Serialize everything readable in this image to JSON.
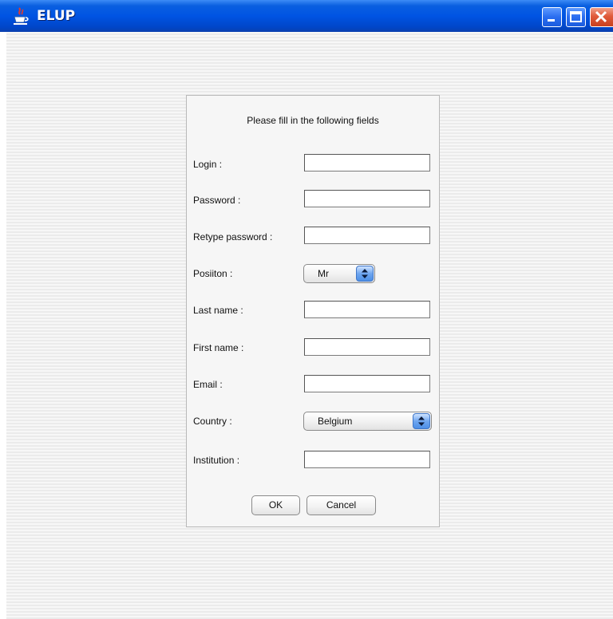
{
  "window": {
    "title": "ELUP",
    "icon": "java-cup-icon"
  },
  "form": {
    "heading": "Please fill in the following fields",
    "login_label": "Login :",
    "login_value": "",
    "password_label": "Password :",
    "password_value": "",
    "retype_label": "Retype password :",
    "retype_value": "",
    "position_label": "Posiiton :",
    "position_value": "Mr",
    "lastname_label": "Last name :",
    "lastname_value": "",
    "firstname_label": "First name :",
    "firstname_value": "",
    "email_label": "Email :",
    "email_value": "",
    "country_label": "Country :",
    "country_value": "Belgium",
    "institution_label": "Institution :",
    "institution_value": "",
    "ok_label": "OK",
    "cancel_label": "Cancel"
  },
  "colors": {
    "titlebar": "#0054e3",
    "close_button": "#e05a3a",
    "combo_arrow": "#4d8fe6"
  }
}
